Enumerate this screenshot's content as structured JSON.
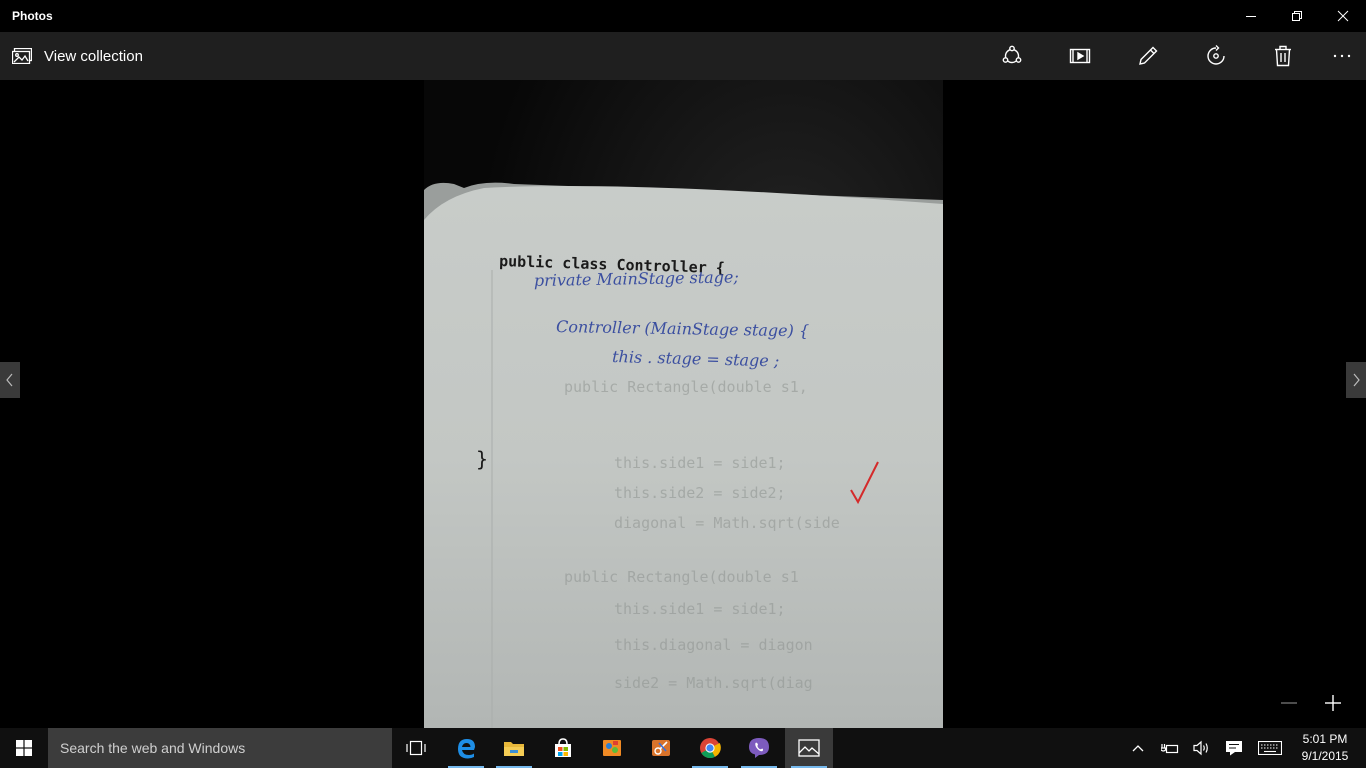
{
  "window": {
    "title": "Photos"
  },
  "appbar": {
    "view_collection_label": "View collection",
    "commands": [
      "share-icon",
      "slideshow-icon",
      "edit-icon",
      "rotate-icon",
      "delete-icon",
      "more-icon"
    ]
  },
  "photo": {
    "code_line_1": "public class Controller {",
    "handwritten_1": "private   MainStage   stage;",
    "handwritten_2": "Controller (MainStage  stage) {",
    "handwritten_3": "this . stage  = stage ;",
    "code_close": "}",
    "background_code": [
      "public Rectangle(double s1,",
      "this.side1 = side1;",
      "this.side2 = side2;",
      "diagonal = Math.sqrt(side",
      "public Rectangle(double s1",
      "this.side1 = side1;",
      "this.diagonal = diagon",
      "side2 = Math.sqrt(diag"
    ]
  },
  "taskbar": {
    "search_placeholder": "Search the web and Windows",
    "time": "5:01 PM",
    "date": "9/1/2015"
  },
  "colors": {
    "appbar": "#1f1f1f",
    "taskbar": "#101010",
    "search_box": "#3c3c3c",
    "accent": "#76b9ed",
    "ink": "#3b4fa0",
    "check_mark": "#d42a2a"
  }
}
